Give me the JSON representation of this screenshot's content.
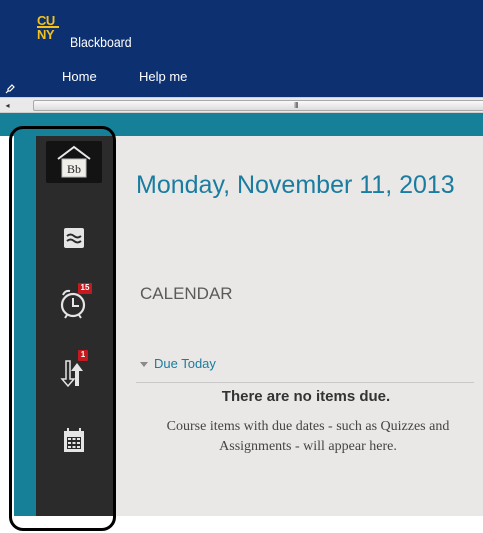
{
  "header": {
    "logo_top": "CU",
    "logo_bottom": "NY",
    "brand": "Blackboard",
    "nav": {
      "home": "Home",
      "help": "Help me"
    },
    "background_color": "#0d3170",
    "logo_color": "#f4c21c"
  },
  "scrollbar": {
    "left_arrow": "◂",
    "grip": "III"
  },
  "sidebar": {
    "items": [
      {
        "name": "home",
        "icon": "bb-home-icon"
      },
      {
        "name": "activity-stream",
        "icon": "wave-stream-icon"
      },
      {
        "name": "due-dates",
        "icon": "alarm-clock-icon",
        "badge": "15"
      },
      {
        "name": "grades",
        "icon": "up-down-arrows-icon",
        "badge": "1"
      },
      {
        "name": "calendar",
        "icon": "calendar-grid-icon"
      }
    ],
    "home_icon_text": "Bb",
    "background_color": "#2b2b2b",
    "accent_color": "#168098"
  },
  "main": {
    "date_title": "Monday, November 11, 2013",
    "section_title": "CALENDAR",
    "due_today_label": "Due Today",
    "empty_heading": "There are no items due.",
    "empty_body": "Course items with due dates - such as Quizzes and Assignments - will appear here.",
    "title_color": "#1a7ca0",
    "badge_color": "#c41a1f"
  }
}
